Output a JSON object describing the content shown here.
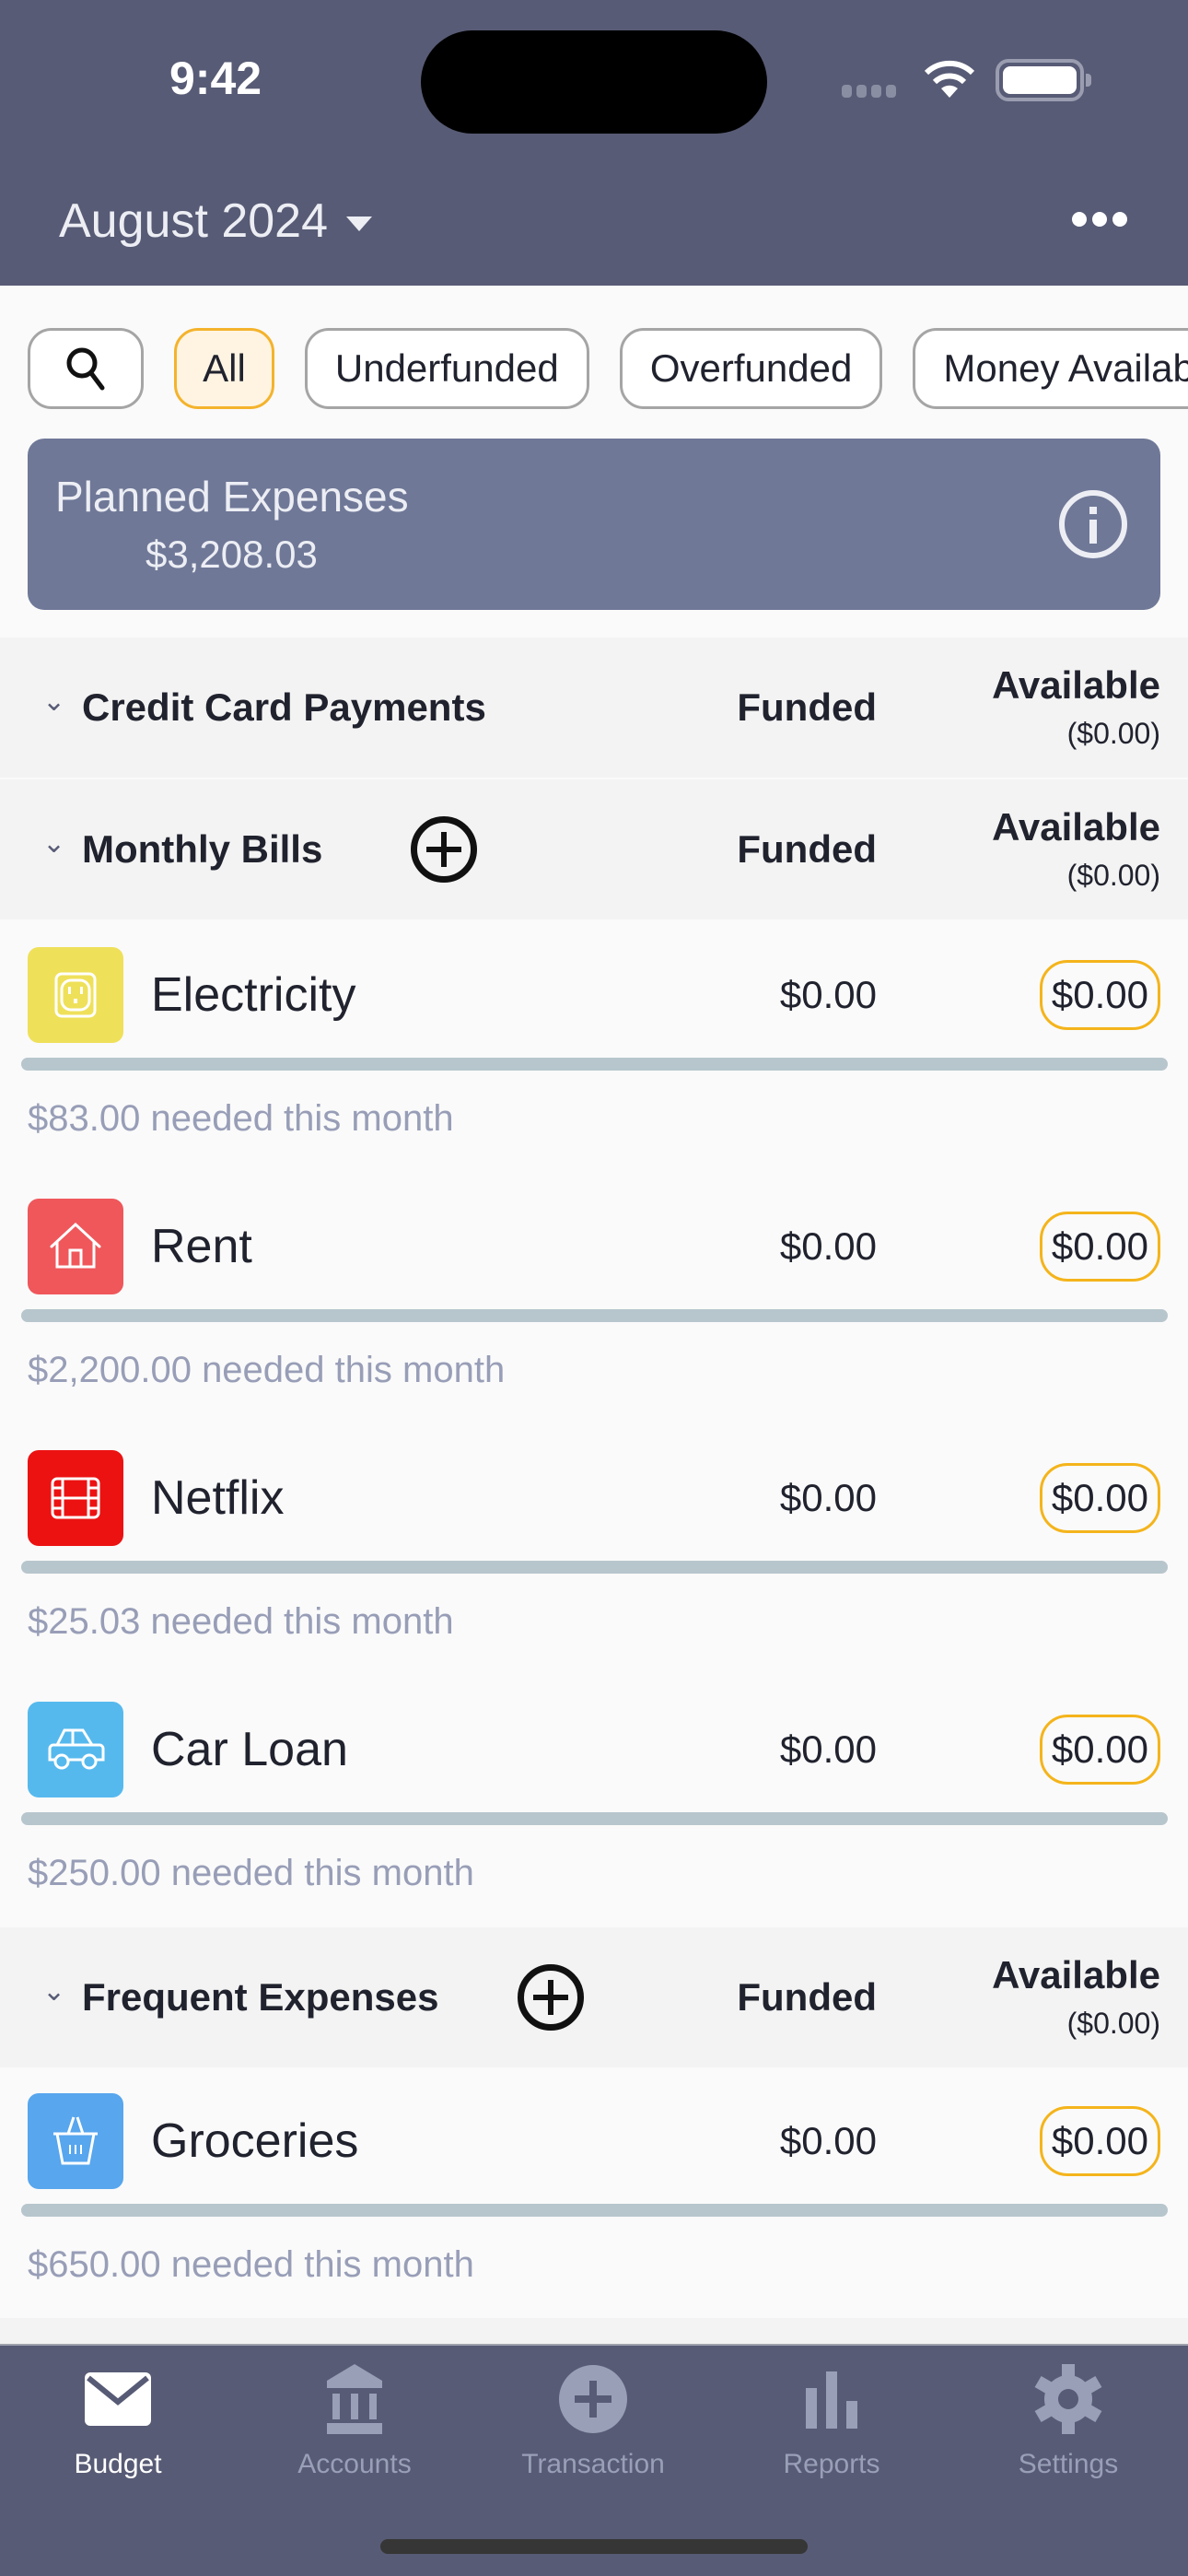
{
  "status_bar": {
    "time": "9:42"
  },
  "header": {
    "month": "August 2024",
    "more_icon": "ellipsis-icon"
  },
  "filters": {
    "search_icon": "search-icon",
    "chips": [
      {
        "label": "All",
        "active": true
      },
      {
        "label": "Underfunded",
        "active": false
      },
      {
        "label": "Overfunded",
        "active": false
      },
      {
        "label": "Money Available",
        "active": false
      }
    ]
  },
  "planned": {
    "label": "Planned Expenses",
    "value": "$3,208.03",
    "icon": "info-icon"
  },
  "sections": [
    {
      "title": "Credit Card Payments",
      "funded_header": "Funded",
      "available_header": "Available",
      "available_total": "($0.00)",
      "has_add": false,
      "rows": []
    },
    {
      "title": "Monthly Bills",
      "funded_header": "Funded",
      "available_header": "Available",
      "available_total": "($0.00)",
      "has_add": true,
      "rows": [
        {
          "name": "Electricity",
          "icon": "outlet-icon",
          "color": "#efe05a",
          "funded": "$0.00",
          "available": "$0.00",
          "progress": 0,
          "needed": "$83.00 needed this month"
        },
        {
          "name": "Rent",
          "icon": "house-icon",
          "color": "#ef575b",
          "funded": "$0.00",
          "available": "$0.00",
          "progress": 0,
          "needed": "$2,200.00 needed this month"
        },
        {
          "name": "Netflix",
          "icon": "film-icon",
          "color": "#ec1212",
          "funded": "$0.00",
          "available": "$0.00",
          "progress": 0,
          "needed": "$25.03 needed this month"
        },
        {
          "name": "Car Loan",
          "icon": "car-icon",
          "color": "#56b9ee",
          "funded": "$0.00",
          "available": "$0.00",
          "progress": 0,
          "needed": "$250.00 needed this month"
        }
      ]
    },
    {
      "title": "Frequent Expenses",
      "funded_header": "Funded",
      "available_header": "Available",
      "available_total": "($0.00)",
      "has_add": true,
      "rows": [
        {
          "name": "Groceries",
          "icon": "basket-icon",
          "color": "#57a6ee",
          "funded": "$0.00",
          "available": "$0.00",
          "progress": 0,
          "needed": "$650.00 needed this month"
        }
      ]
    }
  ],
  "tabbar": {
    "tabs": [
      {
        "label": "Budget",
        "icon": "envelope-icon",
        "active": true
      },
      {
        "label": "Accounts",
        "icon": "bank-icon",
        "active": false
      },
      {
        "label": "Transaction",
        "icon": "plus-circle-icon",
        "active": false
      },
      {
        "label": "Reports",
        "icon": "bar-chart-icon",
        "active": false
      },
      {
        "label": "Settings",
        "icon": "gear-icon",
        "active": false
      }
    ]
  }
}
